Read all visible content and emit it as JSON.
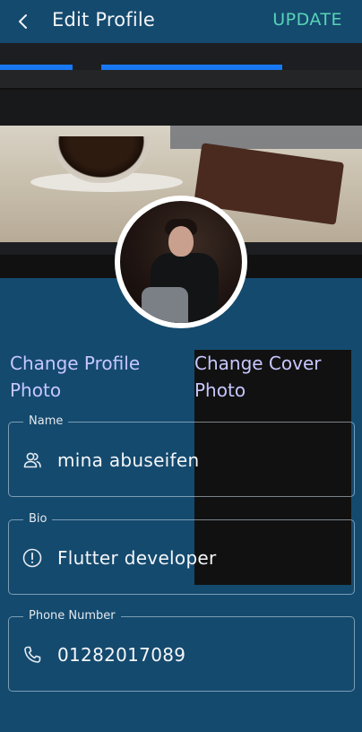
{
  "header": {
    "title": "Edit Profile",
    "update_label": "UPDATE"
  },
  "actions": {
    "change_profile_photo": "Change Profile\nPhoto",
    "change_cover_photo": "Change Cover\nPhoto"
  },
  "fields": {
    "name": {
      "label": "Name",
      "value": "mina abuseifen"
    },
    "bio": {
      "label": "Bio",
      "value": "Flutter developer"
    },
    "phone": {
      "label": "Phone Number",
      "value": "01282017089"
    }
  },
  "icons": {
    "back": "back-arrow-icon",
    "name": "people-icon",
    "bio": "info-icon",
    "phone": "phone-icon"
  },
  "colors": {
    "background": "#144a6e",
    "accent": "#57d3b7",
    "link": "#c7c7ff",
    "text": "#f5f7fa"
  }
}
